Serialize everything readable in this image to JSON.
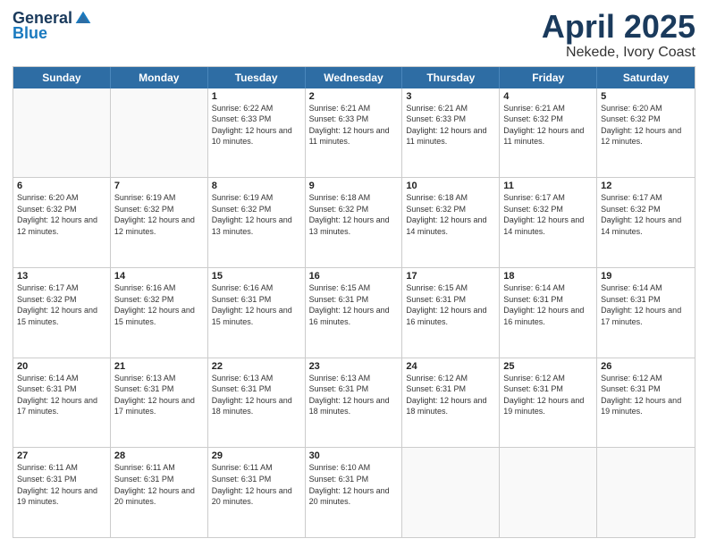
{
  "logo": {
    "general": "General",
    "blue": "Blue"
  },
  "title": {
    "month": "April 2025",
    "location": "Nekede, Ivory Coast"
  },
  "days": [
    "Sunday",
    "Monday",
    "Tuesday",
    "Wednesday",
    "Thursday",
    "Friday",
    "Saturday"
  ],
  "weeks": [
    [
      {
        "day": "",
        "sunrise": "",
        "sunset": "",
        "daylight": "",
        "empty": true
      },
      {
        "day": "",
        "sunrise": "",
        "sunset": "",
        "daylight": "",
        "empty": true
      },
      {
        "day": "1",
        "sunrise": "Sunrise: 6:22 AM",
        "sunset": "Sunset: 6:33 PM",
        "daylight": "Daylight: 12 hours and 10 minutes.",
        "empty": false
      },
      {
        "day": "2",
        "sunrise": "Sunrise: 6:21 AM",
        "sunset": "Sunset: 6:33 PM",
        "daylight": "Daylight: 12 hours and 11 minutes.",
        "empty": false
      },
      {
        "day": "3",
        "sunrise": "Sunrise: 6:21 AM",
        "sunset": "Sunset: 6:33 PM",
        "daylight": "Daylight: 12 hours and 11 minutes.",
        "empty": false
      },
      {
        "day": "4",
        "sunrise": "Sunrise: 6:21 AM",
        "sunset": "Sunset: 6:32 PM",
        "daylight": "Daylight: 12 hours and 11 minutes.",
        "empty": false
      },
      {
        "day": "5",
        "sunrise": "Sunrise: 6:20 AM",
        "sunset": "Sunset: 6:32 PM",
        "daylight": "Daylight: 12 hours and 12 minutes.",
        "empty": false
      }
    ],
    [
      {
        "day": "6",
        "sunrise": "Sunrise: 6:20 AM",
        "sunset": "Sunset: 6:32 PM",
        "daylight": "Daylight: 12 hours and 12 minutes.",
        "empty": false
      },
      {
        "day": "7",
        "sunrise": "Sunrise: 6:19 AM",
        "sunset": "Sunset: 6:32 PM",
        "daylight": "Daylight: 12 hours and 12 minutes.",
        "empty": false
      },
      {
        "day": "8",
        "sunrise": "Sunrise: 6:19 AM",
        "sunset": "Sunset: 6:32 PM",
        "daylight": "Daylight: 12 hours and 13 minutes.",
        "empty": false
      },
      {
        "day": "9",
        "sunrise": "Sunrise: 6:18 AM",
        "sunset": "Sunset: 6:32 PM",
        "daylight": "Daylight: 12 hours and 13 minutes.",
        "empty": false
      },
      {
        "day": "10",
        "sunrise": "Sunrise: 6:18 AM",
        "sunset": "Sunset: 6:32 PM",
        "daylight": "Daylight: 12 hours and 14 minutes.",
        "empty": false
      },
      {
        "day": "11",
        "sunrise": "Sunrise: 6:17 AM",
        "sunset": "Sunset: 6:32 PM",
        "daylight": "Daylight: 12 hours and 14 minutes.",
        "empty": false
      },
      {
        "day": "12",
        "sunrise": "Sunrise: 6:17 AM",
        "sunset": "Sunset: 6:32 PM",
        "daylight": "Daylight: 12 hours and 14 minutes.",
        "empty": false
      }
    ],
    [
      {
        "day": "13",
        "sunrise": "Sunrise: 6:17 AM",
        "sunset": "Sunset: 6:32 PM",
        "daylight": "Daylight: 12 hours and 15 minutes.",
        "empty": false
      },
      {
        "day": "14",
        "sunrise": "Sunrise: 6:16 AM",
        "sunset": "Sunset: 6:32 PM",
        "daylight": "Daylight: 12 hours and 15 minutes.",
        "empty": false
      },
      {
        "day": "15",
        "sunrise": "Sunrise: 6:16 AM",
        "sunset": "Sunset: 6:31 PM",
        "daylight": "Daylight: 12 hours and 15 minutes.",
        "empty": false
      },
      {
        "day": "16",
        "sunrise": "Sunrise: 6:15 AM",
        "sunset": "Sunset: 6:31 PM",
        "daylight": "Daylight: 12 hours and 16 minutes.",
        "empty": false
      },
      {
        "day": "17",
        "sunrise": "Sunrise: 6:15 AM",
        "sunset": "Sunset: 6:31 PM",
        "daylight": "Daylight: 12 hours and 16 minutes.",
        "empty": false
      },
      {
        "day": "18",
        "sunrise": "Sunrise: 6:14 AM",
        "sunset": "Sunset: 6:31 PM",
        "daylight": "Daylight: 12 hours and 16 minutes.",
        "empty": false
      },
      {
        "day": "19",
        "sunrise": "Sunrise: 6:14 AM",
        "sunset": "Sunset: 6:31 PM",
        "daylight": "Daylight: 12 hours and 17 minutes.",
        "empty": false
      }
    ],
    [
      {
        "day": "20",
        "sunrise": "Sunrise: 6:14 AM",
        "sunset": "Sunset: 6:31 PM",
        "daylight": "Daylight: 12 hours and 17 minutes.",
        "empty": false
      },
      {
        "day": "21",
        "sunrise": "Sunrise: 6:13 AM",
        "sunset": "Sunset: 6:31 PM",
        "daylight": "Daylight: 12 hours and 17 minutes.",
        "empty": false
      },
      {
        "day": "22",
        "sunrise": "Sunrise: 6:13 AM",
        "sunset": "Sunset: 6:31 PM",
        "daylight": "Daylight: 12 hours and 18 minutes.",
        "empty": false
      },
      {
        "day": "23",
        "sunrise": "Sunrise: 6:13 AM",
        "sunset": "Sunset: 6:31 PM",
        "daylight": "Daylight: 12 hours and 18 minutes.",
        "empty": false
      },
      {
        "day": "24",
        "sunrise": "Sunrise: 6:12 AM",
        "sunset": "Sunset: 6:31 PM",
        "daylight": "Daylight: 12 hours and 18 minutes.",
        "empty": false
      },
      {
        "day": "25",
        "sunrise": "Sunrise: 6:12 AM",
        "sunset": "Sunset: 6:31 PM",
        "daylight": "Daylight: 12 hours and 19 minutes.",
        "empty": false
      },
      {
        "day": "26",
        "sunrise": "Sunrise: 6:12 AM",
        "sunset": "Sunset: 6:31 PM",
        "daylight": "Daylight: 12 hours and 19 minutes.",
        "empty": false
      }
    ],
    [
      {
        "day": "27",
        "sunrise": "Sunrise: 6:11 AM",
        "sunset": "Sunset: 6:31 PM",
        "daylight": "Daylight: 12 hours and 19 minutes.",
        "empty": false
      },
      {
        "day": "28",
        "sunrise": "Sunrise: 6:11 AM",
        "sunset": "Sunset: 6:31 PM",
        "daylight": "Daylight: 12 hours and 20 minutes.",
        "empty": false
      },
      {
        "day": "29",
        "sunrise": "Sunrise: 6:11 AM",
        "sunset": "Sunset: 6:31 PM",
        "daylight": "Daylight: 12 hours and 20 minutes.",
        "empty": false
      },
      {
        "day": "30",
        "sunrise": "Sunrise: 6:10 AM",
        "sunset": "Sunset: 6:31 PM",
        "daylight": "Daylight: 12 hours and 20 minutes.",
        "empty": false
      },
      {
        "day": "",
        "sunrise": "",
        "sunset": "",
        "daylight": "",
        "empty": true
      },
      {
        "day": "",
        "sunrise": "",
        "sunset": "",
        "daylight": "",
        "empty": true
      },
      {
        "day": "",
        "sunrise": "",
        "sunset": "",
        "daylight": "",
        "empty": true
      }
    ]
  ]
}
